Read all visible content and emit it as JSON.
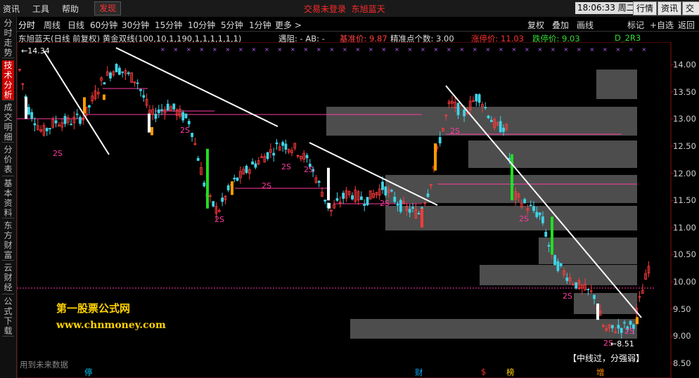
{
  "menu": {
    "items": [
      "资讯",
      "工具",
      "帮助"
    ],
    "active": "发现"
  },
  "status": {
    "login": "交易未登录",
    "stock": "东旭蓝天"
  },
  "clock": {
    "time": "18:06:33",
    "day": "周二"
  },
  "topbuttons": [
    "行情",
    "资讯",
    "交易"
  ],
  "periods": [
    "分时",
    "周线",
    "日线",
    "60分钟",
    "30分钟",
    "15分钟",
    "10分钟",
    "5分钟",
    "1分钟",
    "更多 >"
  ],
  "righttools": [
    "复权",
    "叠加",
    "画线",
    "标记",
    "+自选",
    "返回"
  ],
  "sidebar": [
    "分时走势",
    "技术分析",
    "成交明细",
    "分价表",
    "基本资料",
    "东方财富",
    "云财经",
    "公式下载"
  ],
  "infobar": {
    "title": "东旭蓝天(日线 前复权) 黄金双线(100,10,1,190,1,1,1,1,1,1)",
    "resist": "遇阻: - AB: -",
    "base": "基准价: 9.87",
    "precise": "精准点个数: 3.00",
    "up": "涨停价: 11.03",
    "down": "跌停价: 9.03",
    "code": "D_2R3"
  },
  "watermark": {
    "name": "第一股票公式网",
    "url": "www.chnmoney.com"
  },
  "notes": {
    "future": "用到未来数据",
    "midline": "【中线过，分强弱】",
    "hi": "14.34",
    "lo": "8.51"
  },
  "events": [
    {
      "t": "停",
      "c": "#00ccff"
    },
    {
      "t": "财",
      "c": "#00aaff"
    },
    {
      "t": "$",
      "c": "#ff3030"
    },
    {
      "t": "榜",
      "c": "#ffcc00"
    },
    {
      "t": "增",
      "c": "#ff8800"
    }
  ],
  "chart_data": {
    "type": "candlestick",
    "ylim": [
      8.4,
      14.25
    ],
    "yticks": [
      "14.00",
      "13.50",
      "13.00",
      "12.50",
      "12.00",
      "11.50",
      "11.00",
      "10.50",
      "10.00",
      "9.50",
      "9.00",
      "8.50"
    ],
    "marker_label": "2S",
    "colors": {
      "up": "#ff3b3b",
      "down": "#3fd4e6",
      "box": "#5a5a5a",
      "trend": "#ffffff",
      "mag": "#ff3aa0",
      "green": "#22dd22",
      "orange": "#ff9a00"
    }
  }
}
